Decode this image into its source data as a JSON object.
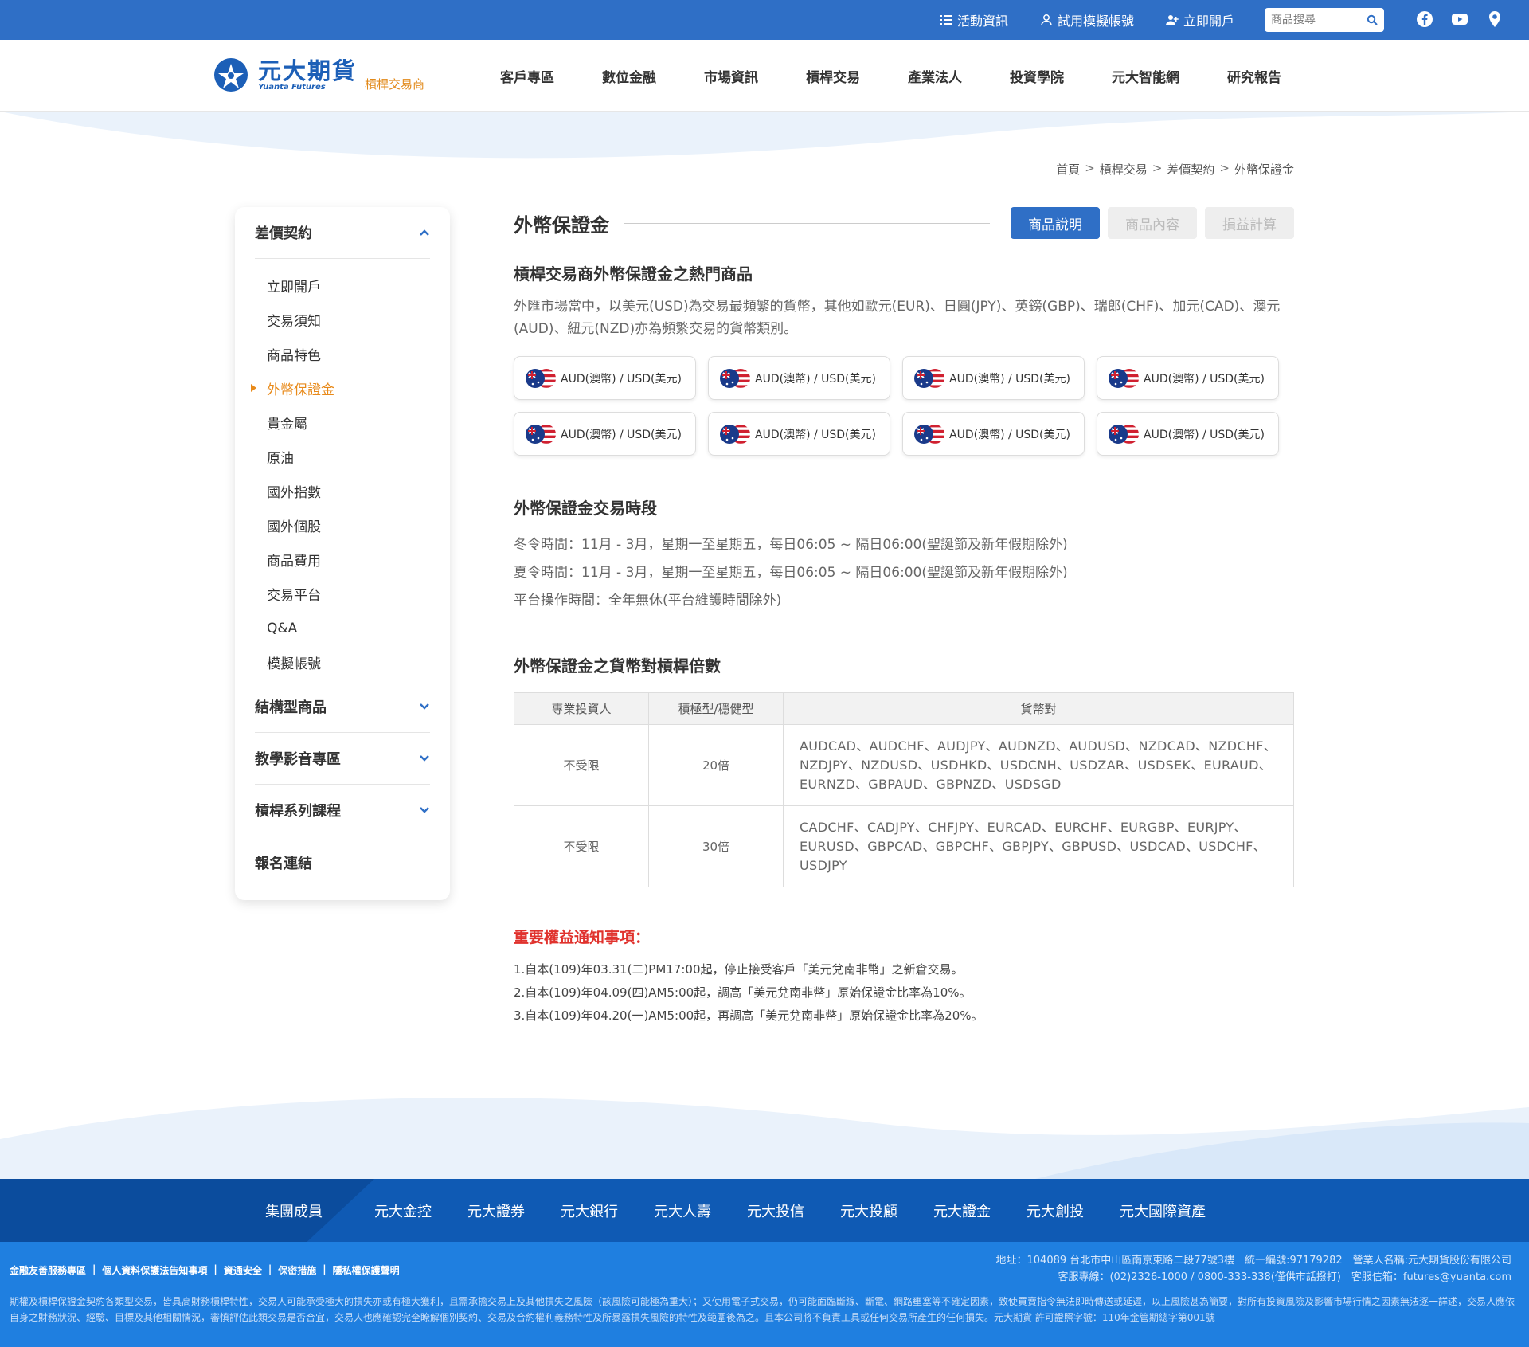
{
  "topbar": {
    "links": [
      "活動資訊",
      "試用模擬帳號",
      "立即開戶"
    ],
    "search_placeholder": "商品搜尋"
  },
  "header": {
    "logo_name": "元大期貨",
    "logo_en": "Yuanta Futures",
    "logo_sub": "槓桿交易商",
    "nav": [
      "客戶專區",
      "數位金融",
      "市場資訊",
      "槓桿交易",
      "產業法人",
      "投資學院",
      "元大智能網",
      "研究報告"
    ]
  },
  "breadcrumb": [
    "首頁",
    "槓桿交易",
    "差價契約",
    "外幣保證金"
  ],
  "sidebar": {
    "section1": "差價契約",
    "items": [
      "立即開戶",
      "交易須知",
      "商品特色",
      "外幣保證金",
      "貴金屬",
      "原油",
      "國外指數",
      "國外個股",
      "商品費用",
      "交易平台",
      "Q&A",
      "模擬帳號"
    ],
    "active_index": 3,
    "sections": [
      "結構型商品",
      "教學影音專區",
      "槓桿系列課程",
      "報名連結"
    ]
  },
  "main": {
    "title": "外幣保證金",
    "tabs": [
      "商品說明",
      "商品內容",
      "損益計算"
    ],
    "hot_title": "槓桿交易商外幣保證金之熱門商品",
    "hot_desc": "外匯市場當中，以美元(USD)為交易最頻繁的貨幣，其他如歐元(EUR)、日圓(JPY)、英鎊(GBP)、瑞郎(CHF)、加元(CAD)、澳元(AUD)、紐元(NZD)亦為頻繁交易的貨幣類別。",
    "pairs": [
      "AUD(澳幣) / USD(美元)",
      "AUD(澳幣) / USD(美元)",
      "AUD(澳幣) / USD(美元)",
      "AUD(澳幣) / USD(美元)",
      "AUD(澳幣) / USD(美元)",
      "AUD(澳幣) / USD(美元)",
      "AUD(澳幣) / USD(美元)",
      "AUD(澳幣) / USD(美元)"
    ],
    "hours_title": "外幣保證金交易時段",
    "hours": [
      "冬令時間：11月 - 3月，星期一至星期五，每日06:05 ~ 隔日06:00(聖誕節及新年假期除外)",
      "夏令時間：11月 - 3月，星期一至星期五，每日06:05 ~ 隔日06:00(聖誕節及新年假期除外)",
      "平台操作時間：全年無休(平台維護時間除外)"
    ],
    "lev_title": "外幣保證金之貨幣對槓桿倍數",
    "table": {
      "headers": [
        "專業投資人",
        "積極型/穩健型",
        "貨幣對"
      ],
      "rows": [
        [
          "不受限",
          "20倍",
          "AUDCAD、AUDCHF、AUDJPY、AUDNZD、AUDUSD、NZDCAD、NZDCHF、NZDJPY、NZDUSD、USDHKD、USDCNH、USDZAR、USDSEK、EURAUD、EURNZD、GBPAUD、GBPNZD、USDSGD"
        ],
        [
          "不受限",
          "30倍",
          "CADCHF、CADJPY、CHFJPY、EURCAD、EURCHF、EURGBP、EURJPY、EURUSD、GBPCAD、GBPCHF、GBPJPY、GBPUSD、USDCAD、USDCHF、USDJPY"
        ]
      ]
    },
    "notice_title": "重要權益通知事項：",
    "notices": [
      "1.自本(109)年03.31(二)PM17:00起，停止接受客戶「美元兌南非幣」之新倉交易。",
      "2.自本(109)年04.09(四)AM5:00起，調高「美元兌南非幣」原始保證金比率為10%。",
      "3.自本(109)年04.20(一)AM5:00起，再調高「美元兌南非幣」原始保證金比率為20%。"
    ]
  },
  "footer": {
    "group_label": "集團成員",
    "group_links": [
      "元大金控",
      "元大證券",
      "元大銀行",
      "元大人壽",
      "元大投信",
      "元大投顧",
      "元大證金",
      "元大創投",
      "元大國際資產"
    ],
    "links": [
      "金融友善服務專區",
      "個人資料保護法告知事項",
      "資通安全",
      "保密措施",
      "隱私權保護聲明"
    ],
    "address": "地址：104089 台北市中山區南京東路二段77號3樓　統一編號:97179282　營業人名稱:元大期貨股份有限公司",
    "service": "客服專線：(02)2326-1000 / 0800-333-338(僅供市話撥打)　客服信箱：futures@yuanta.com",
    "disclaimer": "期權及槓桿保證金契約各類型交易，皆具高財務槓桿特性，交易人可能承受極大的損失亦或有極大獲利，且需承擔交易上及其他損失之風險（該風險可能極為重大）；又使用電子式交易，仍可能面臨斷線、斷電、網路壅塞等不確定因素，致使買賣指令無法即時傳送或延遲，以上風險甚為簡要，對所有投資風險及影響市場行情之因素無法逐一詳述，交易人應依自身之財務狀況、經驗、目標及其他相關情況，審慎評估此類交易是否合宜，交易人也應確認完全瞭解個別契約、交易及合約權利義務特性及所暴露損失風險的特性及範圍後為之。且本公司將不負責工具或任何交易所產生的任何損失。元大期貨 許可證照字號：110年金管期總字第001號"
  }
}
